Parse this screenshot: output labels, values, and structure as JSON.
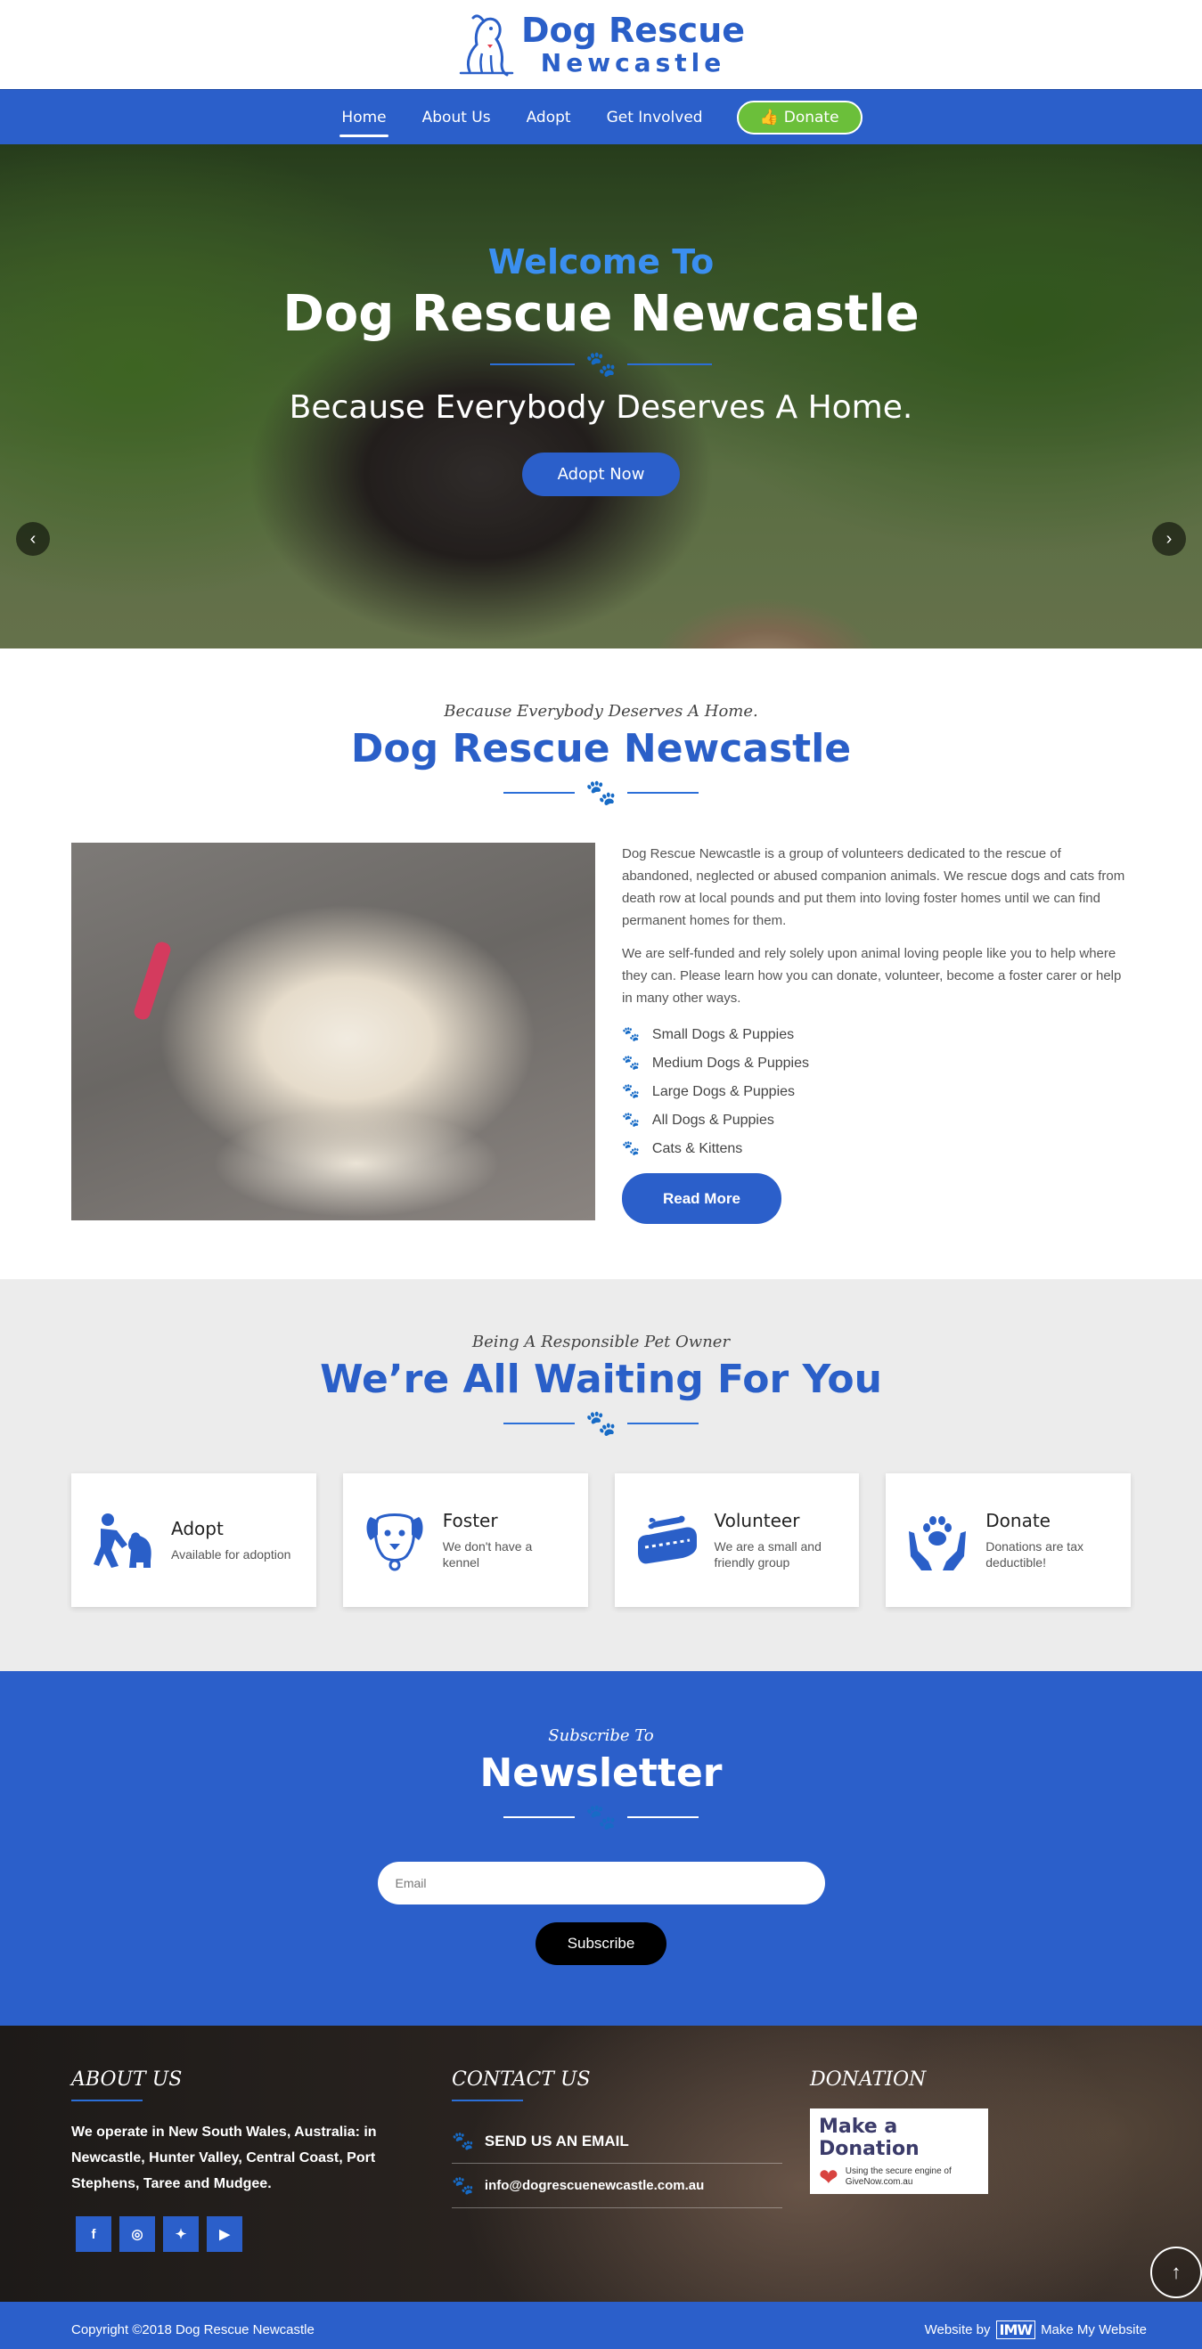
{
  "brand": {
    "line1": "Dog Rescue",
    "line2": "Newcastle"
  },
  "nav": {
    "items": [
      "Home",
      "About Us",
      "Adopt",
      "Get Involved"
    ],
    "active": "Home",
    "donate_label": "Donate"
  },
  "hero": {
    "pre_title": "Welcome To",
    "title": "Dog Rescue Newcastle",
    "subtitle": "Because Everybody Deserves A Home.",
    "button": "Adopt Now"
  },
  "about": {
    "kicker": "Because Everybody Deserves A Home.",
    "title": "Dog Rescue Newcastle",
    "paragraph1": "Dog Rescue Newcastle is a group of volunteers dedicated to the rescue of abandoned, neglected or abused companion animals. We rescue dogs and cats from death row at local pounds and put them into loving foster homes until we can find permanent homes for them.",
    "paragraph2": "We are self-funded and rely solely upon animal loving people like you to help where they can. Please learn how you can donate, volunteer, become a foster carer or help in many other ways.",
    "list": [
      "Small Dogs & Puppies",
      "Medium Dogs & Puppies",
      "Large Dogs & Puppies",
      "All Dogs & Puppies",
      "Cats & Kittens"
    ],
    "button": "Read More"
  },
  "waiting": {
    "kicker": "Being A Responsible Pet Owner",
    "title": "We’re All Waiting For You",
    "cards": [
      {
        "title": "Adopt",
        "desc": "Available for adoption",
        "icon": "person-dog-icon"
      },
      {
        "title": "Foster",
        "desc": "We don't have a kennel",
        "icon": "dog-face-icon"
      },
      {
        "title": "Volunteer",
        "desc": "We are a small and friendly group",
        "icon": "dog-bed-icon"
      },
      {
        "title": "Donate",
        "desc": "Donations are tax deductible!",
        "icon": "hands-paw-icon"
      }
    ]
  },
  "newsletter": {
    "kicker": "Subscribe To",
    "title": "Newsletter",
    "email_placeholder": "Email",
    "button": "Subscribe"
  },
  "footer": {
    "about_heading": "ABOUT US",
    "about_text": "We operate in New South Wales, Australia: in Newcastle, Hunter Valley, Central Coast, Port Stephens, Taree and Mudgee.",
    "socials": [
      "f",
      "ig",
      "tw",
      "yt"
    ],
    "contact_heading": "CONTACT US",
    "contact_email_label": "SEND US AN EMAIL",
    "contact_email": "info@dogrescuenewcastle.com.au",
    "donation_heading": "DONATION",
    "donation_badge_title": "Make a Donation",
    "donation_badge_sub": "Using the secure engine of GiveNow.com.au"
  },
  "copyright": {
    "left": "Copyright ©2018 Dog Rescue Newcastle",
    "right_prefix": "Website by",
    "right_logo": "IMW",
    "right_name": "Make My Website"
  },
  "colors": {
    "primary": "#2b5fca",
    "accent": "#6bbf3a",
    "heading": "#2a5fc8"
  }
}
